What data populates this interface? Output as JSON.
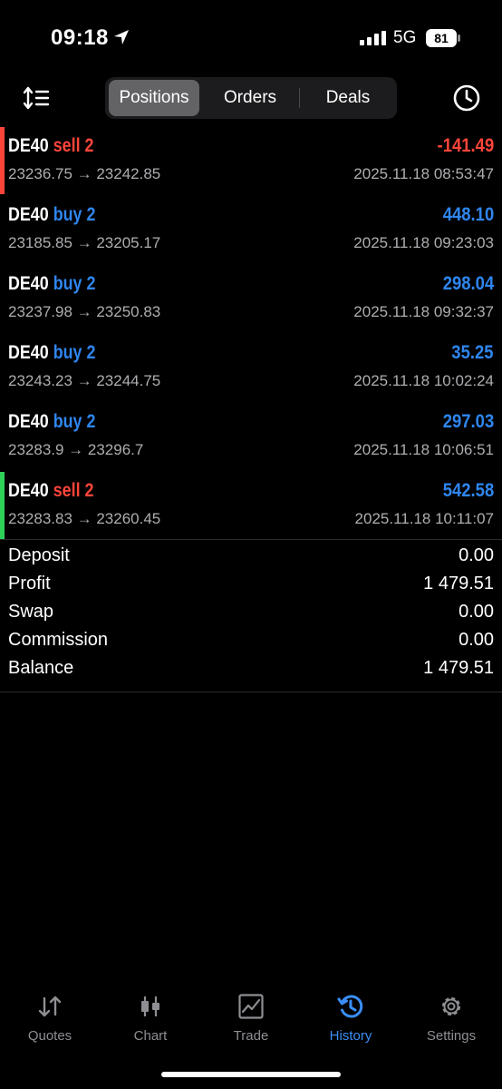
{
  "status": {
    "time": "09:18",
    "network": "5G",
    "battery": "81"
  },
  "tabs": [
    {
      "label": "Positions"
    },
    {
      "label": "Orders"
    },
    {
      "label": "Deals"
    }
  ],
  "positions": [
    {
      "symbol": "DE40",
      "side": "sell 2",
      "side_color": "#ff453a",
      "bar_color": "#ff453a",
      "profit": "-141.49",
      "profit_color": "#ff453a",
      "prices": "23236.75 → 23242.85",
      "datetime": "2025.11.18 08:53:47"
    },
    {
      "symbol": "DE40",
      "side": "buy 2",
      "side_color": "#2f86ef",
      "bar_color": "",
      "profit": "448.10",
      "profit_color": "#2f86ef",
      "prices": "23185.85 → 23205.17",
      "datetime": "2025.11.18 09:23:03"
    },
    {
      "symbol": "DE40",
      "side": "buy 2",
      "side_color": "#2f86ef",
      "bar_color": "",
      "profit": "298.04",
      "profit_color": "#2f86ef",
      "prices": "23237.98 → 23250.83",
      "datetime": "2025.11.18 09:32:37"
    },
    {
      "symbol": "DE40",
      "side": "buy 2",
      "side_color": "#2f86ef",
      "bar_color": "",
      "profit": "35.25",
      "profit_color": "#2f86ef",
      "prices": "23243.23 → 23244.75",
      "datetime": "2025.11.18 10:02:24"
    },
    {
      "symbol": "DE40",
      "side": "buy 2",
      "side_color": "#2f86ef",
      "bar_color": "",
      "profit": "297.03",
      "profit_color": "#2f86ef",
      "prices": "23283.9 → 23296.7",
      "datetime": "2025.11.18 10:06:51"
    },
    {
      "symbol": "DE40",
      "side": "sell 2",
      "side_color": "#ff453a",
      "bar_color": "#30d158",
      "profit": "542.58",
      "profit_color": "#2f86ef",
      "prices": "23283.83 → 23260.45",
      "datetime": "2025.11.18 10:11:07"
    }
  ],
  "summary": [
    {
      "label": "Deposit",
      "value": "0.00"
    },
    {
      "label": "Profit",
      "value": "1 479.51"
    },
    {
      "label": "Swap",
      "value": "0.00"
    },
    {
      "label": "Commission",
      "value": "0.00"
    },
    {
      "label": "Balance",
      "value": "1 479.51"
    }
  ],
  "tabbar": [
    {
      "label": "Quotes",
      "icon": "quotes-icon"
    },
    {
      "label": "Chart",
      "icon": "chart-icon"
    },
    {
      "label": "Trade",
      "icon": "trade-icon"
    },
    {
      "label": "History",
      "icon": "history-icon"
    },
    {
      "label": "Settings",
      "icon": "settings-icon"
    }
  ]
}
